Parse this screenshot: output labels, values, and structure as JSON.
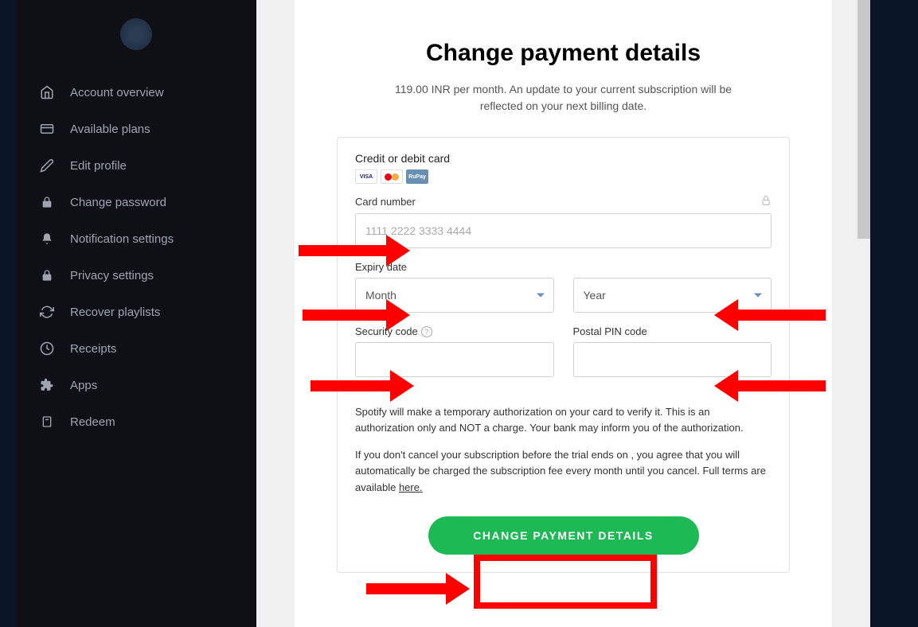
{
  "sidebar": {
    "items": [
      {
        "label": "Account overview",
        "icon": "home"
      },
      {
        "label": "Available plans",
        "icon": "card"
      },
      {
        "label": "Edit profile",
        "icon": "pencil"
      },
      {
        "label": "Change password",
        "icon": "lock"
      },
      {
        "label": "Notification settings",
        "icon": "bell"
      },
      {
        "label": "Privacy settings",
        "icon": "lock"
      },
      {
        "label": "Recover playlists",
        "icon": "refresh"
      },
      {
        "label": "Receipts",
        "icon": "clock"
      },
      {
        "label": "Apps",
        "icon": "puzzle"
      },
      {
        "label": "Redeem",
        "icon": "redeem"
      }
    ]
  },
  "page": {
    "title": "Change payment details",
    "subtitle": "119.00 INR per month. An update to your current subscription will be reflected on your next billing date."
  },
  "form": {
    "card_type_label": "Credit or debit card",
    "visa_text": "VISA",
    "rupay_text": "RuPay",
    "card_number_label": "Card number",
    "card_number_placeholder": "1111 2222 3333 4444",
    "expiry_label": "Expiry date",
    "month_placeholder": "Month",
    "year_placeholder": "Year",
    "security_label": "Security code",
    "postal_label": "Postal PIN code",
    "info1": "Spotify will make a temporary authorization on your card to verify it. This is an authorization only and NOT a charge. Your bank may inform you of the authorization.",
    "info2_part1": "If you don't cancel your subscription before the trial ends on , you agree that you will automatically be charged the subscription fee every month until you cancel. Full terms are available ",
    "info2_link": "here.",
    "submit_label": "CHANGE PAYMENT DETAILS"
  }
}
